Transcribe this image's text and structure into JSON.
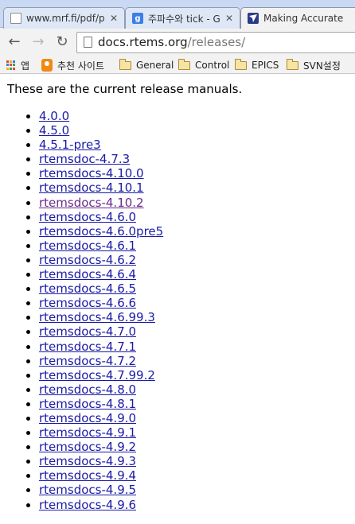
{
  "tabs": [
    {
      "title": "www.mrf.fi/pdf/p",
      "icon": "page-icon",
      "active": false
    },
    {
      "title": "주파수와 tick - G",
      "icon": "google-icon",
      "active": false
    },
    {
      "title": "Making Accurate",
      "icon": "bird-icon",
      "active": true
    }
  ],
  "toolbar": {
    "back": "←",
    "forward": "→",
    "reload": "↻",
    "url_host": "docs.rtems.org",
    "url_path": "/releases/"
  },
  "bookmarks": [
    {
      "label": "앱",
      "icon": "apps-icon"
    },
    {
      "label": "추천 사이트",
      "icon": "suggested-sites-icon"
    },
    {
      "label": "General",
      "icon": "folder-icon"
    },
    {
      "label": "Control",
      "icon": "folder-icon"
    },
    {
      "label": "EPICS",
      "icon": "folder-icon"
    },
    {
      "label": "SVN설정",
      "icon": "folder-icon"
    }
  ],
  "page": {
    "intro": "These are the current release manuals.",
    "releases": [
      "4.0.0",
      "4.5.0",
      "4.5.1-pre3",
      "rtemsdoc-4.7.3",
      "rtemsdocs-4.10.0",
      "rtemsdocs-4.10.1",
      "rtemsdocs-4.10.2",
      "rtemsdocs-4.6.0",
      "rtemsdocs-4.6.0pre5",
      "rtemsdocs-4.6.1",
      "rtemsdocs-4.6.2",
      "rtemsdocs-4.6.4",
      "rtemsdocs-4.6.5",
      "rtemsdocs-4.6.6",
      "rtemsdocs-4.6.99.3",
      "rtemsdocs-4.7.0",
      "rtemsdocs-4.7.1",
      "rtemsdocs-4.7.2",
      "rtemsdocs-4.7.99.2",
      "rtemsdocs-4.8.0",
      "rtemsdocs-4.8.1",
      "rtemsdocs-4.9.0",
      "rtemsdocs-4.9.1",
      "rtemsdocs-4.9.2",
      "rtemsdocs-4.9.3",
      "rtemsdocs-4.9.4",
      "rtemsdocs-4.9.5",
      "rtemsdocs-4.9.6"
    ],
    "visited": [
      "rtemsdocs-4.10.2"
    ]
  },
  "colors": {
    "link": "#1a1aa6",
    "visited_link": "#6b2b8c",
    "tabstrip": "#c9d9f3",
    "toolbar": "#f2f2f2"
  }
}
